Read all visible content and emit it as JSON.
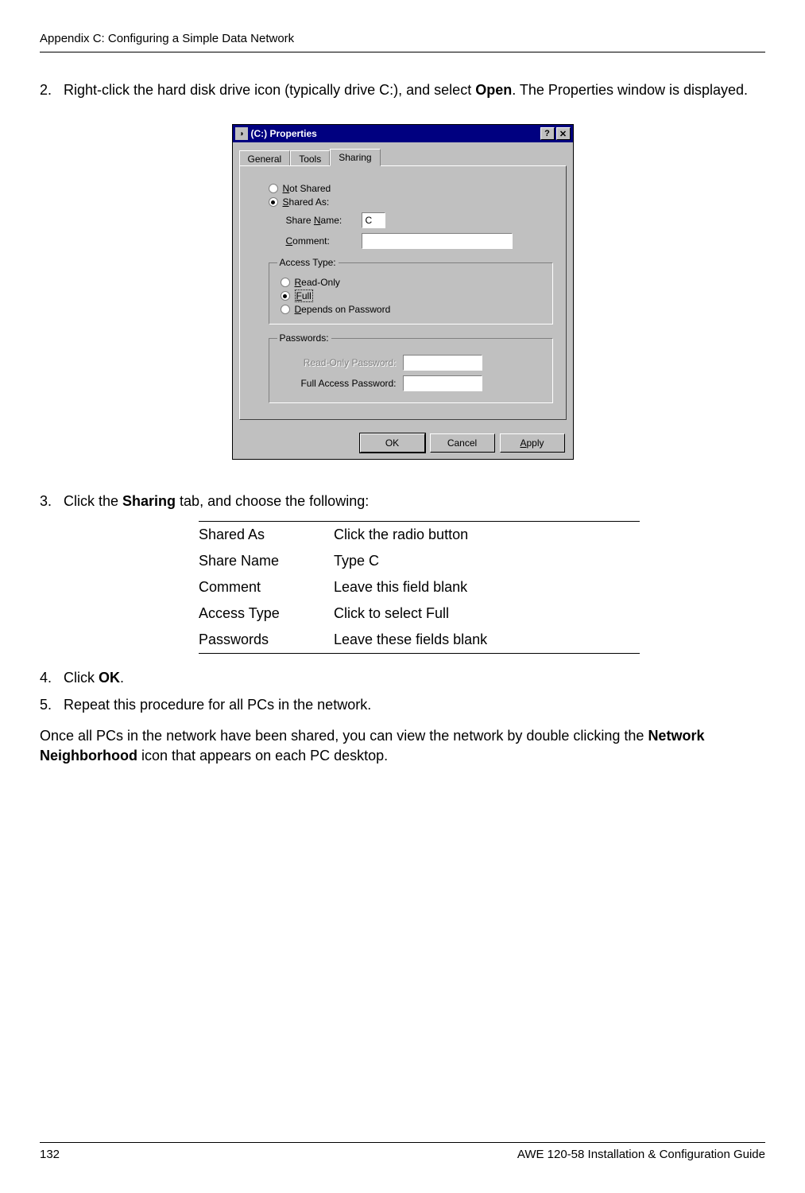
{
  "header": {
    "left": "Appendix C: Configuring a Simple Data Network"
  },
  "steps": {
    "s2": {
      "num": "2.",
      "pre": "Right-click the hard disk drive icon (typically drive C:), and select ",
      "bold": "Open",
      "post": ". The Properties window is displayed."
    },
    "s3": {
      "num": "3.",
      "pre": "Click the ",
      "bold": "Sharing",
      "post": " tab, and choose the following:"
    },
    "s4": {
      "num": "4.",
      "pre": "Click ",
      "bold": "OK",
      "post": "."
    },
    "s5": {
      "num": "5.",
      "text": "Repeat this procedure for all PCs in the network."
    }
  },
  "dialog": {
    "title": "(C:) Properties",
    "help": "?",
    "close": "✕",
    "tabs": {
      "general": "General",
      "tools": "Tools",
      "sharing": "Sharing"
    },
    "radio": {
      "notshared_pre": "N",
      "notshared_post": "ot Shared",
      "sharedas_pre": "S",
      "sharedas_post": "hared As:"
    },
    "fields": {
      "sharename_pre": "Share ",
      "sharename_u": "N",
      "sharename_post": "ame:",
      "sharename_value": "C",
      "comment_u": "C",
      "comment_post": "omment:",
      "comment_value": ""
    },
    "access": {
      "legend": "Access Type:",
      "read_u": "R",
      "read_post": "ead-Only",
      "full_u": "F",
      "full_post": "ull",
      "depends_u": "D",
      "depends_post": "epends on Password"
    },
    "passwords": {
      "legend": "Passwords:",
      "ro_u": "",
      "ro_label": "Read-Only Password:",
      "full_label": "Full Access Password:",
      "ro_value": "",
      "full_value": ""
    },
    "buttons": {
      "ok": "OK",
      "cancel": "Cancel",
      "apply_u": "A",
      "apply_post": "pply"
    }
  },
  "table": {
    "r1k": "Shared As",
    "r1v": "Click the radio button",
    "r2k": "Share Name",
    "r2v": "Type C",
    "r3k": "Comment",
    "r3v": "Leave this field blank",
    "r4k": "Access Type",
    "r4v": "Click to select Full",
    "r5k": "Passwords",
    "r5v": "Leave these fields blank"
  },
  "para": {
    "pre": "Once all PCs in the network have been shared, you can view the network by double clicking the ",
    "bold": "Network Neighborhood",
    "post": " icon that appears on each PC desktop."
  },
  "footer": {
    "page": "132",
    "right": "AWE 120-58 Installation & Configuration Guide"
  }
}
